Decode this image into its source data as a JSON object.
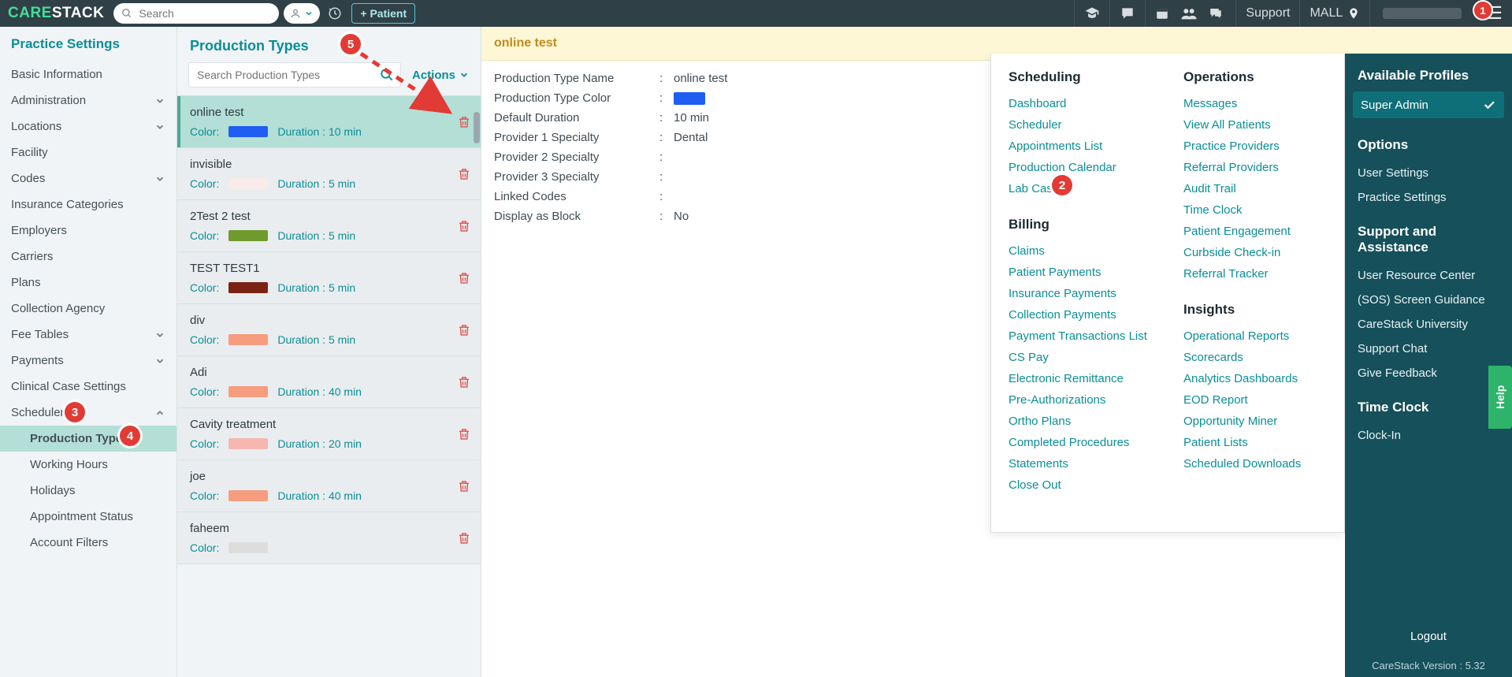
{
  "topbar": {
    "logo_left": "CARE",
    "logo_right": "STACK",
    "search_placeholder": "Search",
    "patient_button": "+ Patient",
    "support": "Support",
    "location": "MALL",
    "hamburger_badge": "1"
  },
  "sidebar": {
    "title": "Practice Settings",
    "items": [
      {
        "label": "Basic Information",
        "expandable": false
      },
      {
        "label": "Administration",
        "expandable": true
      },
      {
        "label": "Locations",
        "expandable": true
      },
      {
        "label": "Facility",
        "expandable": false
      },
      {
        "label": "Codes",
        "expandable": true
      },
      {
        "label": "Insurance Categories",
        "expandable": false
      },
      {
        "label": "Employers",
        "expandable": false
      },
      {
        "label": "Carriers",
        "expandable": false
      },
      {
        "label": "Plans",
        "expandable": false
      },
      {
        "label": "Collection Agency",
        "expandable": false
      },
      {
        "label": "Fee Tables",
        "expandable": true
      },
      {
        "label": "Payments",
        "expandable": true
      },
      {
        "label": "Clinical Case Settings",
        "expandable": false
      },
      {
        "label": "Scheduler",
        "expandable": true,
        "expanded": true,
        "children": [
          {
            "label": "Production Types",
            "active": true
          },
          {
            "label": "Working Hours"
          },
          {
            "label": "Holidays"
          },
          {
            "label": "Appointment Status"
          },
          {
            "label": "Account Filters"
          }
        ]
      }
    ]
  },
  "list": {
    "title": "Production Types",
    "search_placeholder": "Search Production Types",
    "actions_label": "Actions",
    "items": [
      {
        "name": "online test",
        "color": "#1f5ef2",
        "duration": "10 min",
        "selected": true
      },
      {
        "name": "invisible",
        "color": "#fbeaea",
        "duration": "5 min"
      },
      {
        "name": "2Test 2 test",
        "color": "#6f9a2e",
        "duration": "5 min"
      },
      {
        "name": "TEST TEST1",
        "color": "#7a2315",
        "duration": "5 min"
      },
      {
        "name": "div",
        "color": "#f59d7e",
        "duration": "5 min"
      },
      {
        "name": "Adi",
        "color": "#f59d7e",
        "duration": "40 min"
      },
      {
        "name": "Cavity treatment",
        "color": "#f6b7b1",
        "duration": "20 min"
      },
      {
        "name": "joe",
        "color": "#f59d7e",
        "duration": "40 min"
      },
      {
        "name": "faheem",
        "color": "#dddddd",
        "duration": ""
      }
    ],
    "color_label": "Color:",
    "duration_label": "Duration :"
  },
  "detail": {
    "header": "online test",
    "rows": [
      {
        "k": "Production Type Name",
        "v": "online test"
      },
      {
        "k": "Production Type Color",
        "v_color": "#1f5ef2"
      },
      {
        "k": "Default Duration",
        "v": "10 min"
      },
      {
        "k": "Provider 1 Specialty",
        "v": "Dental "
      },
      {
        "k": "Provider 2 Specialty",
        "v": ""
      },
      {
        "k": "Provider 3 Specialty",
        "v": ""
      },
      {
        "k": "Linked Codes",
        "v": ""
      },
      {
        "k": "Display as Block",
        "v": "No"
      }
    ]
  },
  "mega": {
    "col1": [
      {
        "heading": "Scheduling",
        "links": [
          "Dashboard",
          "Scheduler",
          "Appointments List",
          "Production Calendar",
          "Lab Cases"
        ]
      },
      {
        "heading": "Billing",
        "links": [
          "Claims",
          "Patient Payments",
          "Insurance Payments",
          "Collection Payments",
          "Payment Transactions List",
          "CS Pay",
          "Electronic Remittance",
          "Pre-Authorizations",
          "Ortho Plans",
          "Completed Procedures",
          "Statements",
          "Close Out"
        ]
      }
    ],
    "col2": [
      {
        "heading": "Operations",
        "links": [
          "Messages",
          "View All Patients",
          "Practice Providers",
          "Referral Providers",
          "Audit Trail",
          "Time Clock",
          "Patient Engagement",
          "Curbside Check-in",
          "Referral Tracker"
        ]
      },
      {
        "heading": "Insights",
        "links": [
          "Operational Reports",
          "Scorecards",
          "Analytics Dashboards",
          "EOD Report",
          "Opportunity Miner",
          "Patient Lists",
          "Scheduled Downloads"
        ]
      }
    ]
  },
  "right_panel": {
    "profiles_heading": "Available Profiles",
    "profile_selected": "Super Admin",
    "options_heading": "Options",
    "options": [
      "User Settings",
      "Practice Settings"
    ],
    "support_heading": "Support and Assistance",
    "support": [
      "User Resource Center",
      "(SOS) Screen Guidance",
      "CareStack University",
      "Support Chat",
      "Give Feedback"
    ],
    "timeclock_heading": "Time Clock",
    "timeclock": [
      "Clock-In"
    ],
    "logout": "Logout",
    "version": "CareStack Version : 5.32"
  },
  "help_tab": "Help",
  "steps": {
    "1": "1",
    "2": "2",
    "3": "3",
    "4": "4",
    "5": "5"
  }
}
